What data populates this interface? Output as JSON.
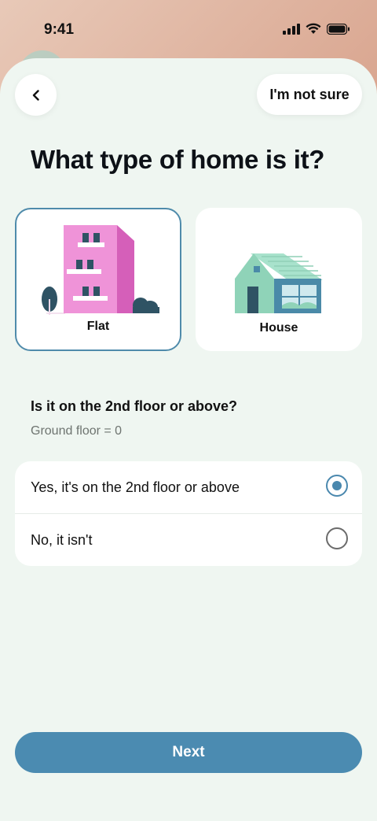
{
  "status_bar": {
    "time": "9:41",
    "icons": [
      "cellular-signal-icon",
      "wifi-icon",
      "battery-icon"
    ]
  },
  "header": {
    "back_icon": "chevron-left-icon",
    "not_sure_label": "I'm not sure"
  },
  "title": "What type of home is it?",
  "home_types": [
    {
      "label": "Flat",
      "selected": true,
      "illustration": "flat-building-icon"
    },
    {
      "label": "House",
      "selected": false,
      "illustration": "house-icon"
    }
  ],
  "floor_question": {
    "title": "Is it on the 2nd floor or above?",
    "hint": "Ground floor = 0",
    "options": [
      {
        "label": "Yes, it's on the 2nd floor or above",
        "selected": true
      },
      {
        "label": "No, it isn't",
        "selected": false
      }
    ]
  },
  "next_label": "Next",
  "colors": {
    "accent": "#4b8bb1",
    "sheet_background": "#eff6f1",
    "flat_pink": "#e98ad0",
    "house_green": "#8fd3b8"
  }
}
